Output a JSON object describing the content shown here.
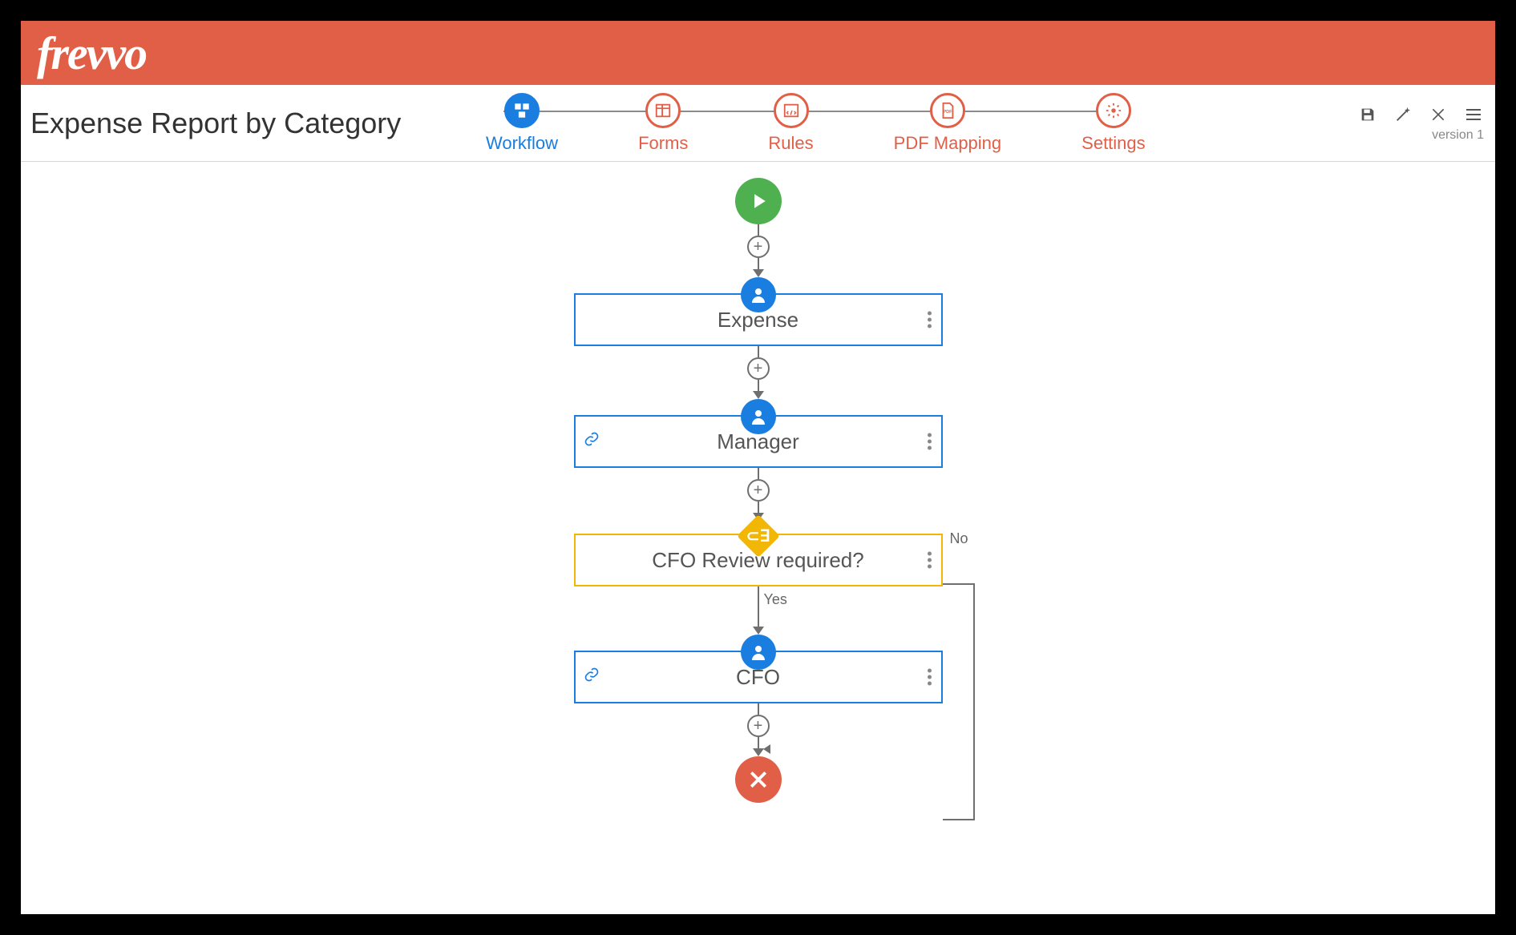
{
  "brand": "frevvo",
  "page_title": "Expense Report by Category",
  "version_label": "version 1",
  "tabs": [
    {
      "label": "Workflow",
      "icon": "workflow",
      "active": true
    },
    {
      "label": "Forms",
      "icon": "forms",
      "active": false
    },
    {
      "label": "Rules",
      "icon": "rules",
      "active": false
    },
    {
      "label": "PDF Mapping",
      "icon": "pdf",
      "active": false
    },
    {
      "label": "Settings",
      "icon": "gear",
      "active": false
    }
  ],
  "toolbar_icons": [
    "save",
    "wand",
    "close",
    "menu"
  ],
  "workflow": {
    "start": "start",
    "end": "end",
    "nodes": [
      {
        "type": "user-step",
        "label": "Expense",
        "linked": false
      },
      {
        "type": "user-step",
        "label": "Manager",
        "linked": true
      },
      {
        "type": "decision",
        "label": "CFO Review required?",
        "yes_label": "Yes",
        "no_label": "No"
      },
      {
        "type": "user-step",
        "label": "CFO",
        "linked": true
      }
    ]
  },
  "colors": {
    "brand_orange": "#e15f47",
    "primary_blue": "#1a7de0",
    "decision_yellow": "#f2b705",
    "start_green": "#4fb04f"
  }
}
